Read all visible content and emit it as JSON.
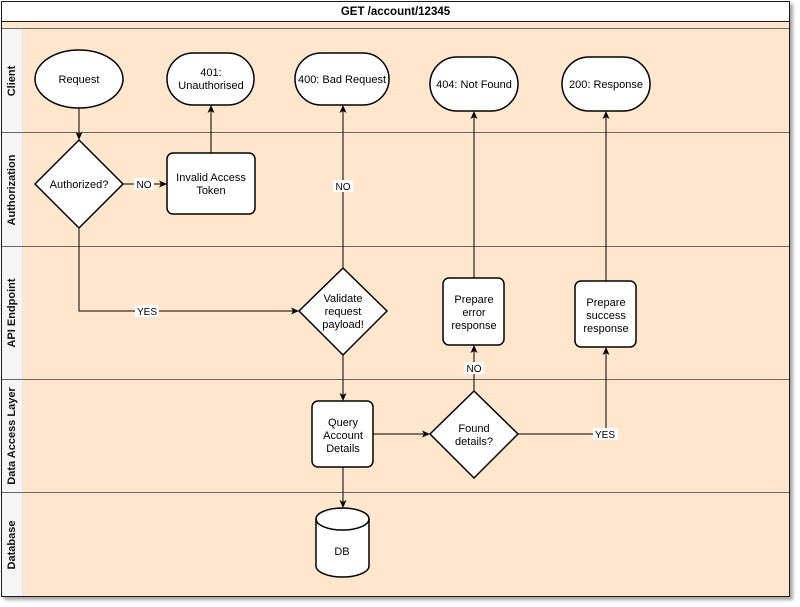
{
  "diagram": {
    "title": "GET /account/12345",
    "colors": {
      "lane_fill": "#FFE6CC",
      "label_column_fill": "#F5F5F5",
      "shape_fill": "#FFFFFF",
      "stroke": "#000000"
    },
    "lanes": [
      {
        "id": "client",
        "label": "Client"
      },
      {
        "id": "authorization",
        "label": "Authorization"
      },
      {
        "id": "api-endpoint",
        "label": "API Endpoint"
      },
      {
        "id": "data-access-layer",
        "label": "Data Access Layer"
      },
      {
        "id": "database",
        "label": "Database"
      }
    ],
    "nodes": {
      "request": {
        "type": "ellipse",
        "lane": "Client",
        "lines": [
          "Request"
        ]
      },
      "unauthorised": {
        "type": "terminator",
        "lane": "Client",
        "lines": [
          "401:",
          "Unauthorised"
        ]
      },
      "bad_request": {
        "type": "terminator",
        "lane": "Client",
        "lines": [
          "400: Bad Request"
        ]
      },
      "not_found": {
        "type": "terminator",
        "lane": "Client",
        "lines": [
          "404: Not Found"
        ]
      },
      "response": {
        "type": "terminator",
        "lane": "Client",
        "lines": [
          "200: Response"
        ]
      },
      "authorized": {
        "type": "decision",
        "lane": "Authorization",
        "lines": [
          "Authorized?"
        ]
      },
      "invalid_token": {
        "type": "process",
        "lane": "Authorization",
        "lines": [
          "Invalid Access",
          "Token"
        ]
      },
      "validate": {
        "type": "decision",
        "lane": "API Endpoint",
        "lines": [
          "Validate",
          "request",
          "payload!"
        ]
      },
      "prepare_error": {
        "type": "process",
        "lane": "API Endpoint",
        "lines": [
          "Prepare",
          "error",
          "response"
        ]
      },
      "prepare_success": {
        "type": "process",
        "lane": "API Endpoint",
        "lines": [
          "Prepare",
          "success",
          "response"
        ]
      },
      "query": {
        "type": "process",
        "lane": "Data Access Layer",
        "lines": [
          "Query",
          "Account",
          "Details"
        ]
      },
      "found": {
        "type": "decision",
        "lane": "Data Access Layer",
        "lines": [
          "Found",
          "details?"
        ]
      },
      "db": {
        "type": "cylinder",
        "lane": "Database",
        "lines": [
          "DB"
        ]
      }
    },
    "edges": [
      {
        "from": "request",
        "to": "authorized",
        "label": ""
      },
      {
        "from": "authorized",
        "to": "invalid_token",
        "label": "NO"
      },
      {
        "from": "invalid_token",
        "to": "unauthorised",
        "label": ""
      },
      {
        "from": "authorized",
        "to": "validate",
        "label": "YES"
      },
      {
        "from": "validate",
        "to": "bad_request",
        "label": "NO"
      },
      {
        "from": "validate",
        "to": "query",
        "label": ""
      },
      {
        "from": "query",
        "to": "db",
        "label": ""
      },
      {
        "from": "query",
        "to": "found",
        "label": ""
      },
      {
        "from": "found",
        "to": "prepare_error",
        "label": "NO"
      },
      {
        "from": "prepare_error",
        "to": "not_found",
        "label": ""
      },
      {
        "from": "found",
        "to": "prepare_success",
        "label": "YES"
      },
      {
        "from": "prepare_success",
        "to": "response",
        "label": ""
      }
    ]
  }
}
